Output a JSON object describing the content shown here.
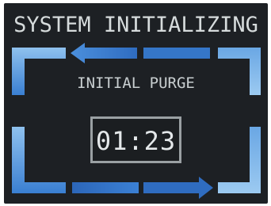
{
  "screen": {
    "title": "SYSTEM INITIALIZING",
    "phase_label": "INITIAL PURGE",
    "countdown": "01:23"
  },
  "colors": {
    "background": "#1d2024",
    "text": "#d6dbdc",
    "bar_light": "#7fb6e8",
    "bar_mid": "#3f86d6",
    "bar_dark": "#2a64b8"
  },
  "icons": {
    "top_arrow": "arrow-left-icon",
    "bottom_arrow": "arrow-right-icon"
  }
}
